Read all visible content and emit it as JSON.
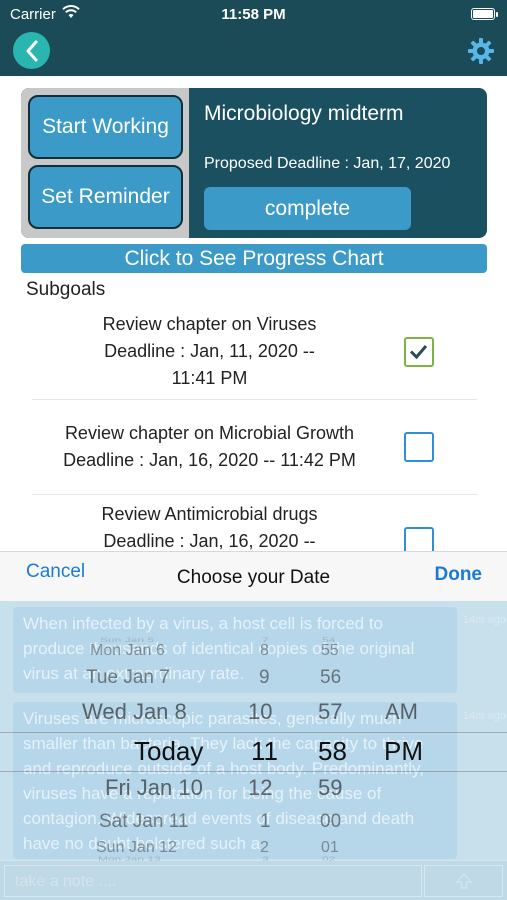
{
  "status_bar": {
    "carrier": "Carrier",
    "time": "11:58 PM"
  },
  "nav": {
    "back_icon": "chevron-left-icon",
    "settings_icon": "gear-icon"
  },
  "goal": {
    "start_label": "Start Working",
    "reminder_label": "Set Reminder",
    "title": "Microbiology midterm",
    "deadline": "Proposed Deadline : Jan, 17, 2020",
    "complete_label": "complete"
  },
  "progress_chart_label": "Click to See Progress Chart",
  "subgoals": {
    "heading": "Subgoals",
    "items": [
      {
        "line1": "Review chapter on Viruses",
        "line2": "Deadline : Jan, 11, 2020 --",
        "line3": "11:41 PM",
        "checked": true
      },
      {
        "line1": "Review chapter on Microbial Growth",
        "line2": "Deadline : Jan, 16, 2020 -- 11:42 PM",
        "line3": "",
        "checked": false
      },
      {
        "line1": "Review Antimicrobial drugs",
        "line2": "Deadline : Jan, 16, 2020 --",
        "line3": "",
        "checked": false
      }
    ]
  },
  "background_notes": {
    "bubble1": "When infected by a virus, a host cell is forced to produce thousands of identical copies of the original virus at an extraordinary rate.",
    "bubble2": "Viruses are microscopic parasites, generally much smaller than bacteria. They lack the capacity to thrive and reproduce outside of a host body. Predominantly, viruses have a reputation for being the cause of contagion. Widespread events of disease and death have no doubt bolstered such a",
    "stamp": "14m ago",
    "input_placeholder": "take a note ....",
    "send_icon": "send-arrow-icon"
  },
  "picker": {
    "cancel_label": "Cancel",
    "title": "Choose your Date",
    "done_label": "Done",
    "dates": [
      "Sun Jan 5",
      "Mon Jan 6",
      "Tue Jan 7",
      "Wed Jan 8",
      "Today",
      "Fri Jan 10",
      "Sat Jan 11",
      "Sun Jan 12",
      "Mon Jan 13"
    ],
    "hours": [
      "7",
      "8",
      "9",
      "10",
      "11",
      "12",
      "1",
      "2",
      "3"
    ],
    "minutes": [
      "54",
      "55",
      "56",
      "57",
      "58",
      "59",
      "00",
      "01",
      "02"
    ],
    "ampm": [
      "AM",
      "PM"
    ],
    "selected": {
      "date": "Today",
      "hour": "11",
      "minute": "58",
      "ampm": "PM"
    }
  }
}
